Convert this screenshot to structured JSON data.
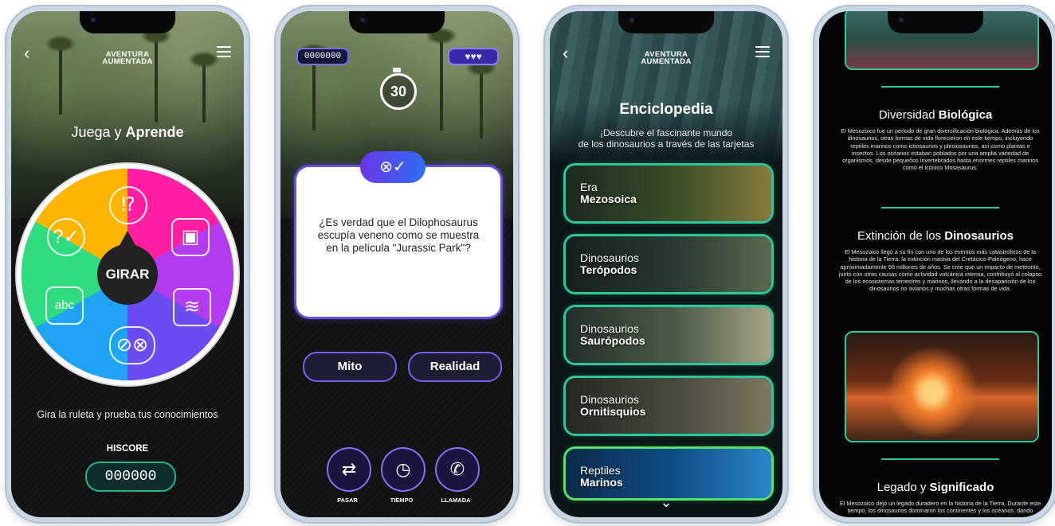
{
  "app": {
    "brand_line1": "AVENTURA",
    "brand_line2": "AUMENTADA"
  },
  "screen1": {
    "title_part1": "Juega y ",
    "title_part2": "Aprende",
    "wheel_center": "GIRAR",
    "subtitle": "Gira la ruleta y prueba tus conocimientos",
    "hiscore_label": "HISCORE",
    "hiscore_value": "000000",
    "wheel_colors": [
      "#ff1fa0",
      "#b43cf0",
      "#6a4cf2",
      "#1ea4f2",
      "#2edb7e",
      "#ffb400"
    ],
    "wheel_icons": [
      "image-icon",
      "cards-icon",
      "myth-reality-icon",
      "abc-icon",
      "chat-question-icon",
      "question-bubble-icon"
    ]
  },
  "screen2": {
    "score": "0000000",
    "hearts": "♥♥♥",
    "timer": "30",
    "badge": "⊗✓",
    "question": "¿Es verdad que el Dilophosaurus escupía veneno como se muestra en la película \"Jurassic Park\"?",
    "answers": [
      "Mito",
      "Realidad"
    ],
    "actions": [
      {
        "icon": "pass-icon",
        "label": "PASAR"
      },
      {
        "icon": "time-icon",
        "label": "TIEMPO"
      },
      {
        "icon": "phone-icon",
        "label": "LLAMADA"
      }
    ]
  },
  "screen3": {
    "title": "Enciclopedia",
    "subtitle_line1": "¡Descubre el fascinante mundo",
    "subtitle_line2": "de los dinosaurios a través de las tarjetas",
    "cards": [
      {
        "line1": "Era",
        "line2": "Mezosoica"
      },
      {
        "line1": "Dinosaurios",
        "line2": "Terópodos"
      },
      {
        "line1": "Dinosaurios",
        "line2": "Saurópodos"
      },
      {
        "line1": "Dinosaurios",
        "line2": "Ornitisquios"
      },
      {
        "line1": "Reptiles",
        "line2": "Marinos"
      }
    ]
  },
  "screen4": {
    "section1_title_a": "Diversidad ",
    "section1_title_b": "Biológica",
    "section1_text": "El Mesozoico fue un periodo de gran diversificación biológica. Además de los dinosaurios, otras formas de vida florecieron en este tiempo, incluyendo reptiles marinos como ictiosaurios y plesiosaurios, así como plantas e insectos. Los océanos estaban poblados por una amplia variedad de organismos, desde pequeños invertebrados hasta enormes reptiles marinos como el icónico Mosasaurus.",
    "section2_title_a": "Extinción de los ",
    "section2_title_b": "Dinosaurios",
    "section2_text": "El Mesozoico llegó a su fin con uno de los eventos más catastróficos de la historia de la Tierra: la extinción masiva del Cretácico-Paleógeno, hace aproximadamente 66 millones de años. Se cree que un impacto de meteorito, junto con otras causas como actividad volcánica intensa, contribuyó al colapso de los ecosistemas terrestres y marinos, llevando a la desaparición de los dinosaurios no avianos y muchas otras formas de vida.",
    "section3_title_a": "Legado y ",
    "section3_title_b": "Significado",
    "section3_text": "El Mesozoico dejó un legado duradero en la historia de la Tierra. Durante este tiempo, los dinosaurios dominaron los continentes y los océanos, dando"
  },
  "colors": {
    "accent_green": "#2cc79a",
    "accent_purple": "#7b5ef2"
  }
}
